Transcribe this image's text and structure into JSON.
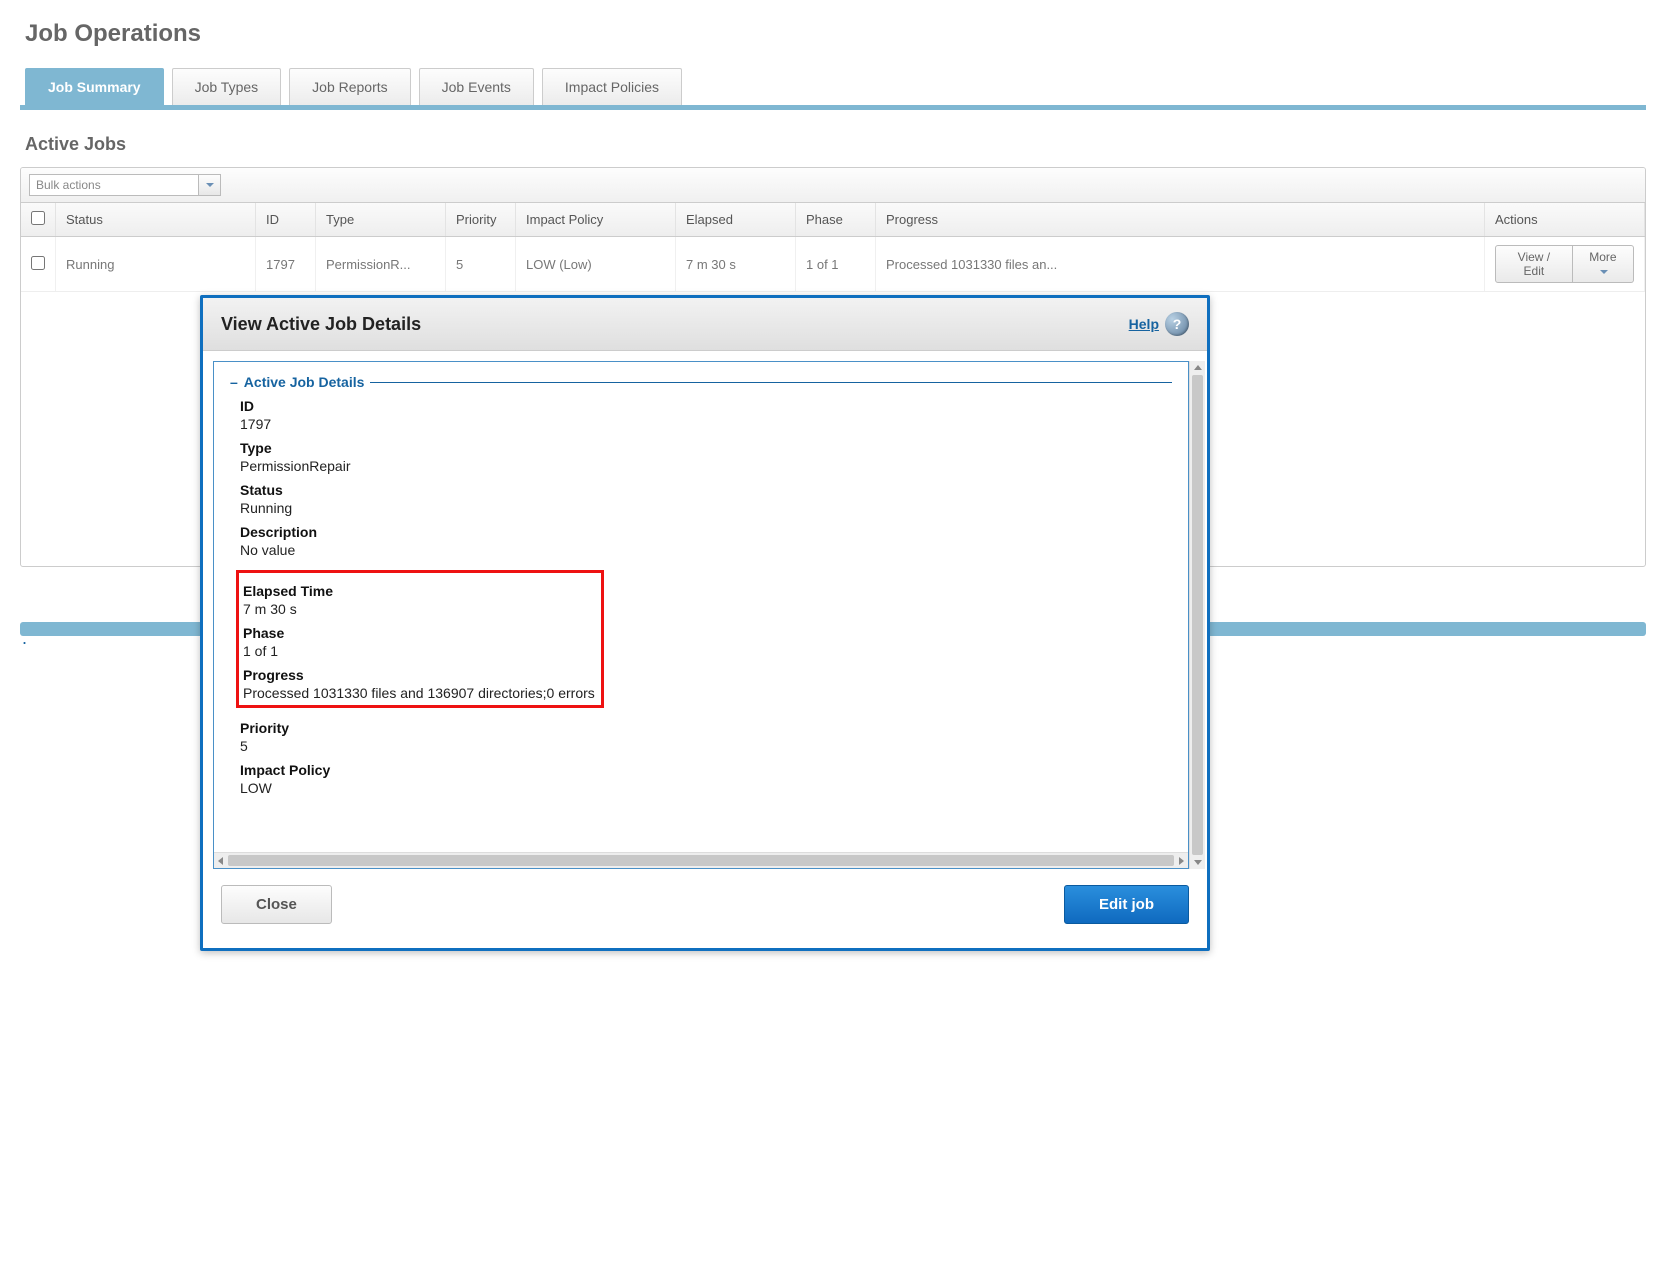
{
  "page_title": "Job Operations",
  "tabs": [
    {
      "label": "Job Summary",
      "active": true
    },
    {
      "label": "Job Types",
      "active": false
    },
    {
      "label": "Job Reports",
      "active": false
    },
    {
      "label": "Job Events",
      "active": false
    },
    {
      "label": "Impact Policies",
      "active": false
    }
  ],
  "section_title": "Active Jobs",
  "bulk_actions_placeholder": "Bulk actions",
  "columns": {
    "status": "Status",
    "id": "ID",
    "type": "Type",
    "priority": "Priority",
    "impact_policy": "Impact Policy",
    "elapsed": "Elapsed",
    "phase": "Phase",
    "progress": "Progress",
    "actions": "Actions"
  },
  "rows": [
    {
      "status": "Running",
      "id": "1797",
      "type": "PermissionR...",
      "priority": "5",
      "impact_policy": "LOW (Low)",
      "elapsed": "7 m 30 s",
      "phase": "1 of 1",
      "progress": "Processed 1031330 files an...",
      "action_view": "View / Edit",
      "action_more": "More"
    }
  ],
  "dialog": {
    "title": "View Active Job Details",
    "help_label": "Help",
    "fieldset_title": "Active Job Details",
    "fields": {
      "id_label": "ID",
      "id_value": "1797",
      "type_label": "Type",
      "type_value": "PermissionRepair",
      "status_label": "Status",
      "status_value": "Running",
      "description_label": "Description",
      "description_value": "No value",
      "elapsed_label": "Elapsed Time",
      "elapsed_value": "7 m 30 s",
      "phase_label": "Phase",
      "phase_value": "1 of 1",
      "progress_label": "Progress",
      "progress_value": "Processed 1031330 files and 136907 directories;0 errors",
      "priority_label": "Priority",
      "priority_value": "5",
      "impact_label": "Impact Policy",
      "impact_value": "LOW"
    },
    "close_label": "Close",
    "edit_label": "Edit job"
  }
}
